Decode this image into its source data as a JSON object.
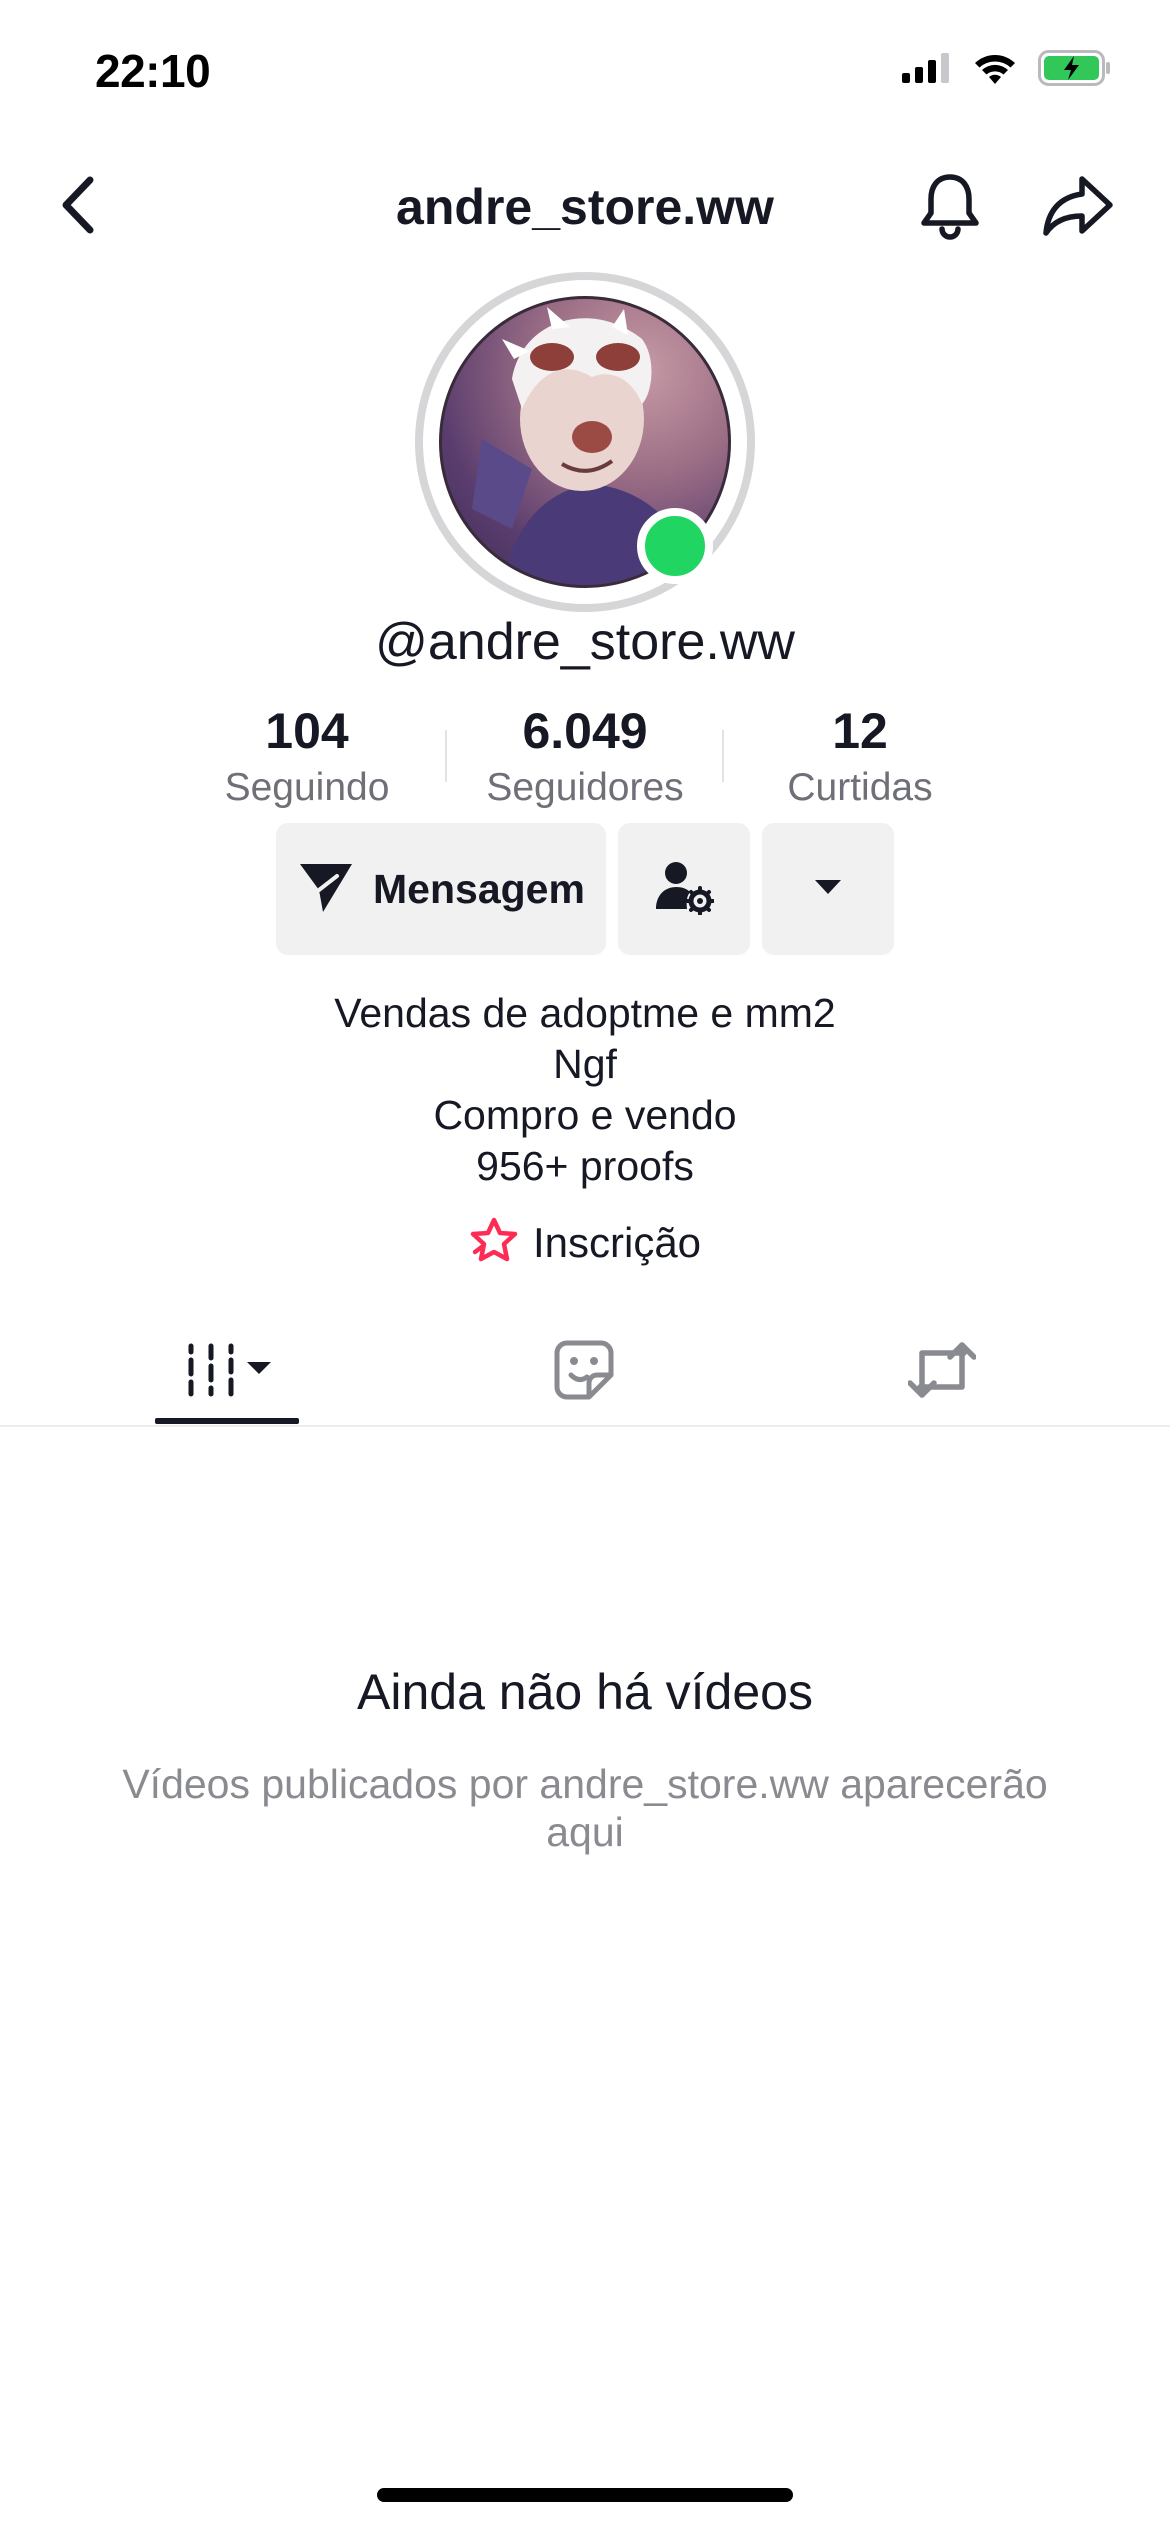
{
  "status_bar": {
    "time": "22:10",
    "icons": [
      "signal-icon",
      "wifi-icon",
      "battery-charging-icon"
    ]
  },
  "nav": {
    "title": "andre_store.ww",
    "icons": [
      "back-arrow-icon",
      "bell-icon",
      "share-icon"
    ]
  },
  "profile": {
    "handle": "@andre_store.ww",
    "online_color": "#20d562",
    "stats": [
      {
        "value": "104",
        "label": "Seguindo"
      },
      {
        "value": "6.049",
        "label": "Seguidores"
      },
      {
        "value": "12",
        "label": "Curtidas"
      }
    ],
    "actions": {
      "message_label": "Mensagem",
      "friends_icon": "user-settings-icon",
      "more_icon": "caret-down-icon"
    },
    "bio_lines": [
      "Vendas de adoptme e mm2",
      "Ngf",
      "Compro e vendo",
      "956+ proofs"
    ],
    "subscription_label": "Inscrição",
    "subscription_color": "#fe2c55"
  },
  "tabs": [
    {
      "name": "videos",
      "icon": "videos-grid-icon",
      "active": true
    },
    {
      "name": "liked",
      "icon": "sticker-icon",
      "active": false
    },
    {
      "name": "reposts",
      "icon": "repost-icon",
      "active": false
    }
  ],
  "empty_state": {
    "title": "Ainda não há vídeos",
    "subtitle": "Vídeos publicados por andre_store.ww aparecerão aqui"
  }
}
